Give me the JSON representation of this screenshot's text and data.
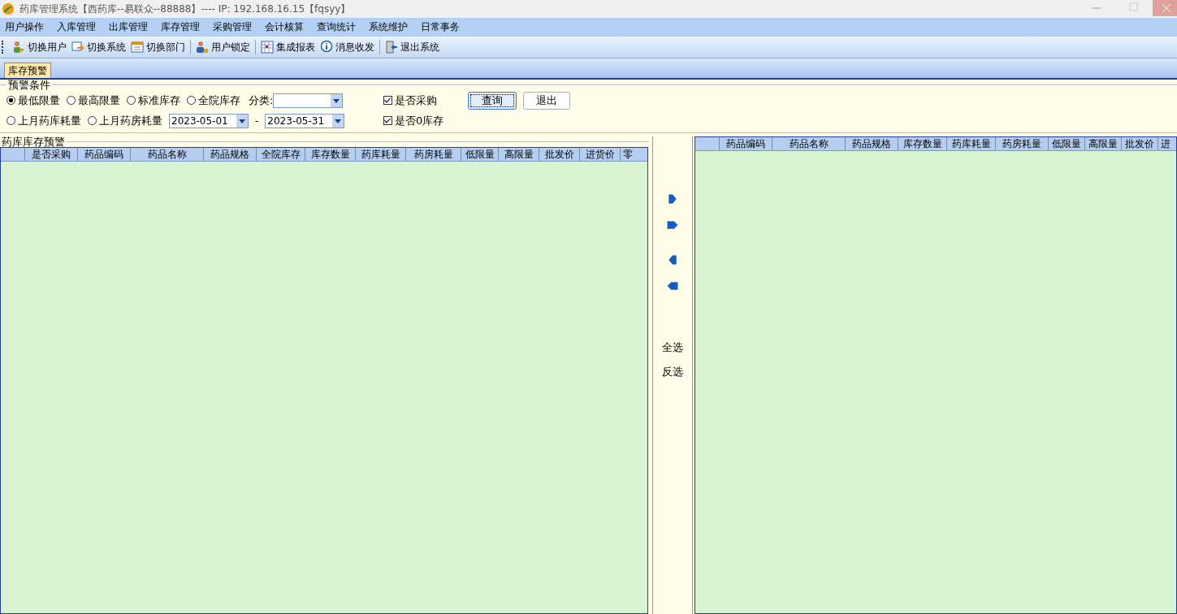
{
  "window": {
    "title": "药库管理系统【西药库--易联众--88888】---- IP:  192.168.16.15【fqsyy】"
  },
  "menu": [
    "用户操作",
    "入库管理",
    "出库管理",
    "库存管理",
    "采购管理",
    "会计核算",
    "查询统计",
    "系统维护",
    "日常事务"
  ],
  "toolbar": [
    {
      "label": "切换用户",
      "kind": "users",
      "separator_after": false
    },
    {
      "label": "切换系统",
      "kind": "switch",
      "separator_after": false
    },
    {
      "label": "切换部门",
      "kind": "calendar",
      "separator_after": true
    },
    {
      "label": "用户锁定",
      "kind": "lock",
      "separator_after": true
    },
    {
      "label": "集成报表",
      "kind": "report",
      "separator_after": false
    },
    {
      "label": "消息收发",
      "kind": "info",
      "separator_after": true
    },
    {
      "label": "退出系统",
      "kind": "exit",
      "separator_after": false
    }
  ],
  "tabs": [
    {
      "label": "库存预警",
      "selected": true
    }
  ],
  "conditions": {
    "title": "预警条件",
    "radios": [
      {
        "label": "最低限量",
        "selected": true
      },
      {
        "label": "最高限量",
        "selected": false
      },
      {
        "label": "标准库存",
        "selected": false
      },
      {
        "label": "全院库存",
        "selected": false
      },
      {
        "label": "上月药库耗量",
        "selected": false
      },
      {
        "label": "上月药房耗量",
        "selected": false
      }
    ],
    "category_label": "分类:",
    "date_from": "2023-05-01",
    "date_separator": "-",
    "date_to": "2023-05-31",
    "checkboxes": [
      {
        "label": "是否采购",
        "checked": true
      },
      {
        "label": "是否0库存",
        "checked": true
      }
    ],
    "buttons": [
      {
        "label": "查询",
        "focused": true
      },
      {
        "label": "退出",
        "focused": false
      }
    ]
  },
  "left_panel": {
    "title": "药库库存预警",
    "columns": [
      "是否采购",
      "药品编码",
      "药品名称",
      "药品规格",
      "全院库存",
      "库存数量",
      "药库耗量",
      "药房耗量",
      "低限量",
      "高限量",
      "批发价",
      "进货价",
      "零"
    ]
  },
  "transfer": {
    "buttons": [
      {
        "kind": "right"
      },
      {
        "kind": "all_right"
      },
      {
        "kind": "left"
      },
      {
        "kind": "all_left"
      }
    ],
    "select_all": "全选",
    "invert": "反选"
  },
  "right_panel": {
    "columns": [
      "药品编码",
      "药品名称",
      "药品规格",
      "库存数量",
      "药库耗量",
      "药房耗量",
      "低限量",
      "高限量",
      "批发价",
      "进"
    ]
  }
}
